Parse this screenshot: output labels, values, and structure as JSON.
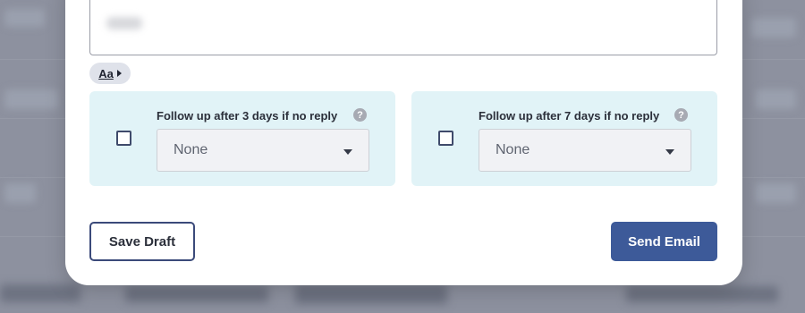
{
  "composer": {
    "format_toggle_label": "Aa"
  },
  "followups": [
    {
      "label": "Follow up after 3 days if no reply",
      "help_glyph": "?",
      "select_value": "None",
      "checked": false
    },
    {
      "label": "Follow up after 7 days if no reply",
      "help_glyph": "?",
      "select_value": "None",
      "checked": false
    }
  ],
  "actions": {
    "save_draft_label": "Save Draft",
    "send_label": "Send Email"
  },
  "colors": {
    "panel_bg": "#e1f3f7",
    "primary_button": "#3d5a99",
    "outline_button_border": "#3b4a7a"
  },
  "icons": {
    "format": "chevron-right-icon",
    "help": "question-circle-icon",
    "select": "chevron-down-icon"
  }
}
